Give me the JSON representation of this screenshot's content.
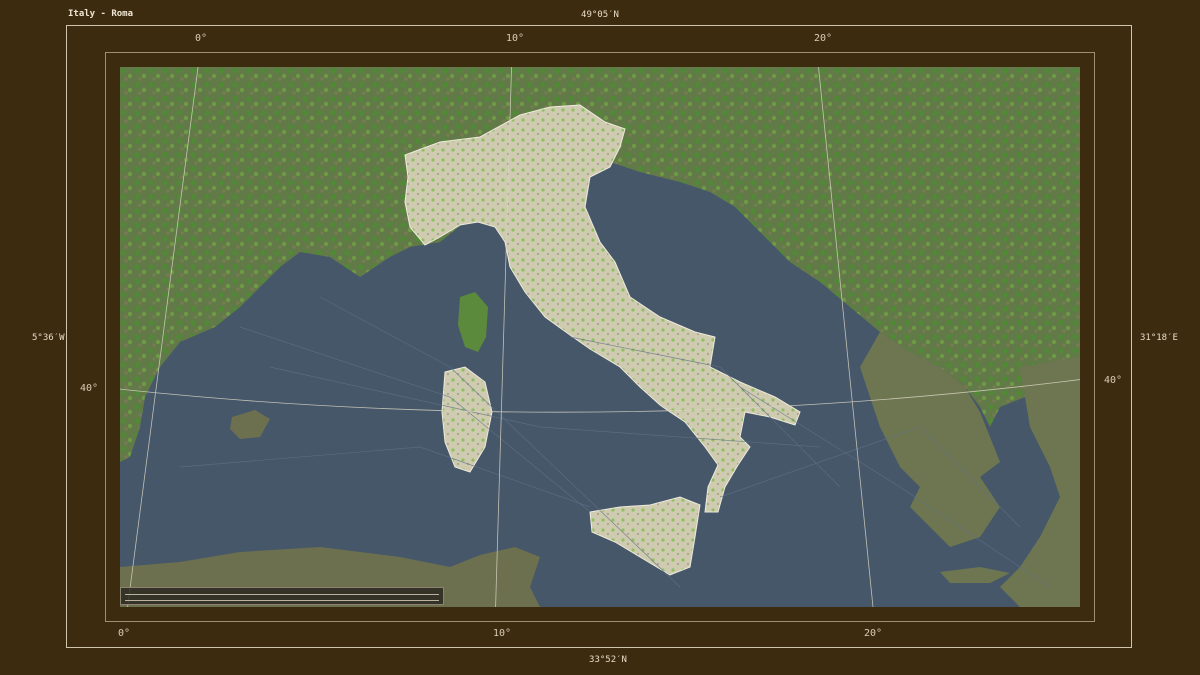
{
  "map": {
    "title": "Italy - Roma",
    "bounds": {
      "north": "49°05′N",
      "south": "33°52′N",
      "west": "5°36′W",
      "east": "31°18′E"
    },
    "graticule": {
      "top_labels": [
        "0°",
        "10°",
        "20°"
      ],
      "bottom_labels": [
        "0°",
        "10°",
        "20°"
      ],
      "left_labels": [
        "40°"
      ],
      "right_labels": [
        "40°"
      ]
    },
    "colors": {
      "frame": "#3d2b10",
      "sea": "#46576a",
      "land_neighbors": "#66784e",
      "highlighted_country": "#c9c5a8",
      "forest": "#5a8c3a",
      "graticule_lines": "#d8d2c2"
    }
  }
}
